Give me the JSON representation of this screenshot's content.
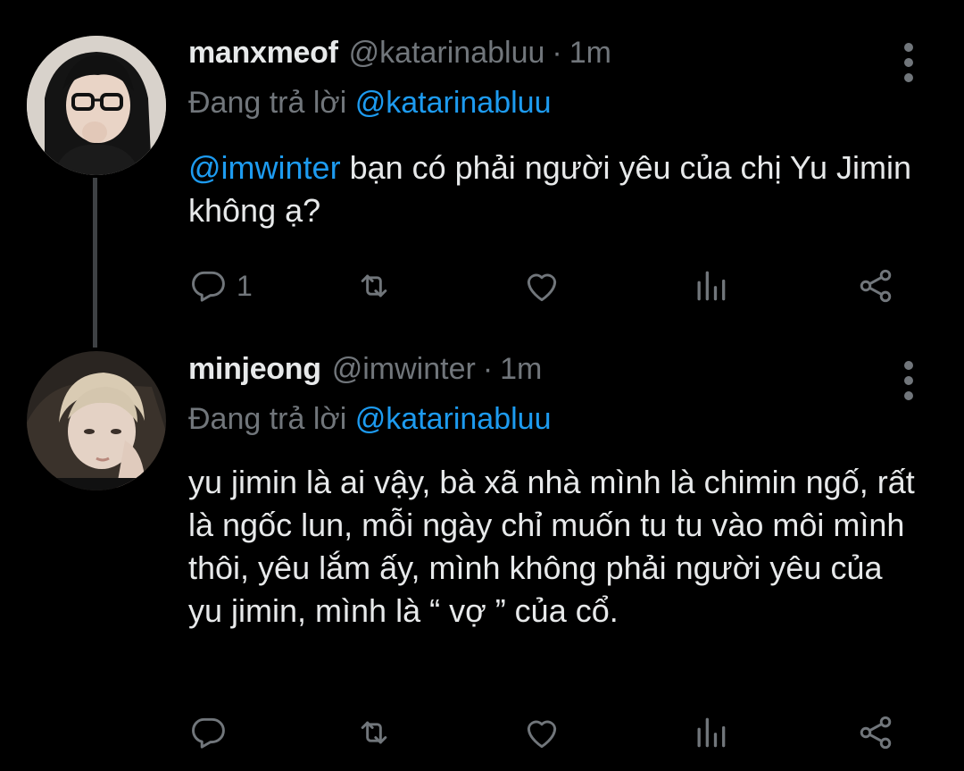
{
  "tweets": [
    {
      "display_name": "manxmeof",
      "handle": "@katarinabluu",
      "separator": "·",
      "time": "1m",
      "reply_prefix": "Đang trả lời",
      "reply_to": "@katarinabluu",
      "mention": "@imwinter",
      "text": " bạn có phải người yêu của chị Yu Jimin không ạ?",
      "reply_count": "1",
      "avatar_icon": "avatar-photo-glasses"
    },
    {
      "display_name": "minjeong",
      "handle": "@imwinter",
      "separator": "·",
      "time": "1m",
      "reply_prefix": "Đang trả lời",
      "reply_to": "@katarinabluu",
      "text": "yu jimin là ai vậy, bà xã nhà mình là chimin ngố, rất là ngốc lun, mỗi ngày chỉ muốn tu tu vào môi mình thôi, yêu lắm ấy, mình không phải người yêu của yu jimin, mình là “ vợ ” của cổ.",
      "reply_count": "",
      "avatar_icon": "avatar-photo-blonde"
    }
  ],
  "colors": {
    "background": "#000000",
    "text": "#e7e9ea",
    "secondary": "#71767b",
    "accent": "#1d9bf0",
    "thread_line": "#3e4144"
  },
  "icons": [
    "reply-icon",
    "retweet-icon",
    "like-icon",
    "views-icon",
    "share-icon",
    "more-icon"
  ]
}
